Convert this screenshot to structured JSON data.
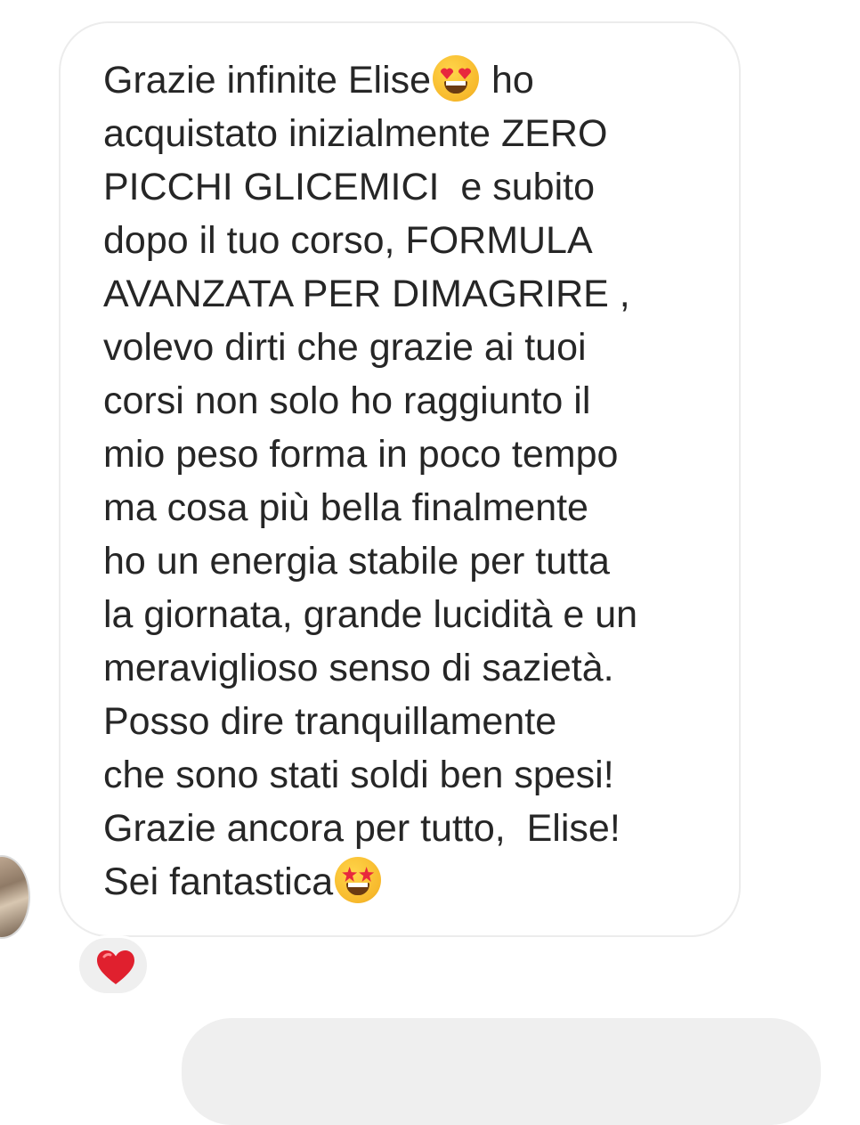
{
  "message": {
    "lines": [
      {
        "before": "Grazie infinite Elise",
        "emoji": "heart-eyes",
        "after": " ho"
      },
      {
        "before": "acquistato inizialmente ZERO",
        "emoji": "",
        "after": ""
      },
      {
        "before": "PICCHI GLICEMICI  e subito",
        "emoji": "",
        "after": ""
      },
      {
        "before": "dopo il tuo corso, FORMULA",
        "emoji": "",
        "after": ""
      },
      {
        "before": "AVANZATA PER DIMAGRIRE ,",
        "emoji": "",
        "after": ""
      },
      {
        "before": "volevo dirti che grazie ai tuoi",
        "emoji": "",
        "after": ""
      },
      {
        "before": "corsi non solo ho raggiunto il",
        "emoji": "",
        "after": ""
      },
      {
        "before": "mio peso forma in poco tempo",
        "emoji": "",
        "after": ""
      },
      {
        "before": "ma cosa più bella finalmente",
        "emoji": "",
        "after": ""
      },
      {
        "before": "ho un energia stabile per tutta",
        "emoji": "",
        "after": ""
      },
      {
        "before": "la giornata, grande lucidità e un",
        "emoji": "",
        "after": ""
      },
      {
        "before": "meraviglioso senso di sazietà.",
        "emoji": "",
        "after": ""
      },
      {
        "before": "Posso dire tranquillamente",
        "emoji": "",
        "after": ""
      },
      {
        "before": "che sono stati soldi ben spesi!",
        "emoji": "",
        "after": ""
      },
      {
        "before": "Grazie ancora per tutto,  Elise!",
        "emoji": "",
        "after": ""
      },
      {
        "before": "Sei fantastica",
        "emoji": "star-struck",
        "after": ""
      }
    ]
  },
  "reaction": {
    "icon": "red-heart-icon"
  },
  "colors": {
    "text": "#262626",
    "bubble_border": "#ececec",
    "reaction_bg": "#efefef",
    "heart": "#e0202e"
  }
}
